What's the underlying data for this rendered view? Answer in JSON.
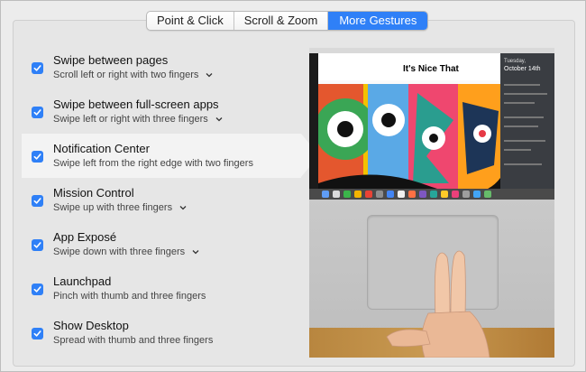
{
  "tabs": [
    {
      "label": "Point & Click"
    },
    {
      "label": "Scroll & Zoom"
    },
    {
      "label": "More Gestures"
    }
  ],
  "active_tab": "More Gestures",
  "accent_color": "#2f80f7",
  "gestures": [
    {
      "title": "Swipe between pages",
      "description": "Scroll left or right with two fingers",
      "checked": true,
      "has_menu": true
    },
    {
      "title": "Swipe between full-screen apps",
      "description": "Swipe left or right with three fingers",
      "checked": true,
      "has_menu": true
    },
    {
      "title": "Notification Center",
      "description": "Swipe left from the right edge with two fingers",
      "checked": true,
      "has_menu": false,
      "selected": true
    },
    {
      "title": "Mission Control",
      "description": "Swipe up with three fingers",
      "checked": true,
      "has_menu": true
    },
    {
      "title": "App Exposé",
      "description": "Swipe down with three fingers",
      "checked": true,
      "has_menu": true
    },
    {
      "title": "Launchpad",
      "description": "Pinch with thumb and three fingers",
      "checked": true,
      "has_menu": false
    },
    {
      "title": "Show Desktop",
      "description": "Spread with thumb and three fingers",
      "checked": true,
      "has_menu": false
    }
  ],
  "preview": {
    "site_title": "It's Nice That",
    "nc_day": "Tuesday,",
    "nc_date": "October 14th"
  },
  "icons": {
    "checkbox": "checkmark-icon",
    "menu": "chevron-down-icon"
  }
}
